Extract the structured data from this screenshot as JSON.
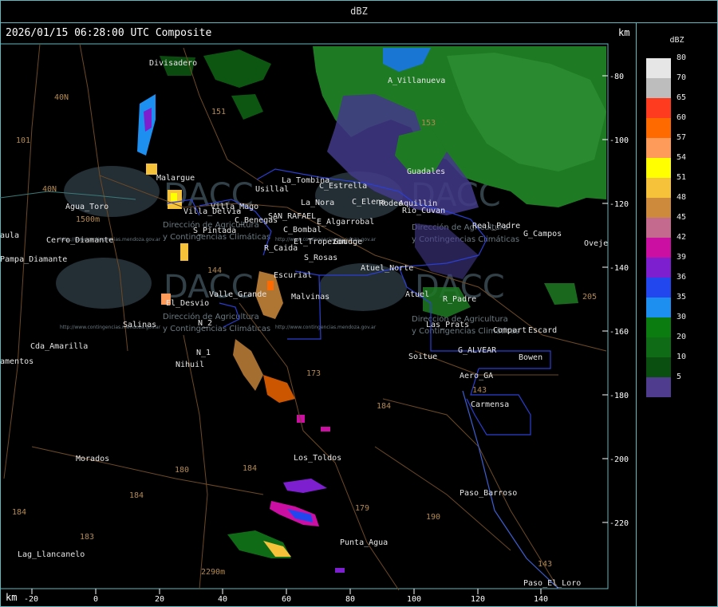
{
  "header": {
    "title": "dBZ"
  },
  "map": {
    "timestamp": "2026/01/15 06:28:00 UTC Composite",
    "unit_top": "km",
    "unit_bottom": "km",
    "x_ticks": [
      "-20",
      "0",
      "20",
      "40",
      "60",
      "80",
      "100",
      "120",
      "140"
    ],
    "y_ticks": [
      "-80",
      "-100",
      "-120",
      "-140",
      "-160",
      "-180",
      "-200",
      "-220"
    ],
    "places": [
      "Divisadero",
      "A_Villanueva",
      "La_Tombina",
      "Usillal",
      "C_Estrella",
      "La_Nora",
      "C_Elena",
      "Rodeo",
      "Aquillin",
      "Rio_Cuvan",
      "Agua_Toro",
      "Cerro_Diamante",
      "Pampa_Diamante",
      "Villa_Mago",
      "C_Benegas",
      "SAN_RAFAEL",
      "E_Algarrobal",
      "C_Bombal",
      "El_Tropezon",
      "Goudge",
      "G_Campos",
      "S_Pintada",
      "R_Caida",
      "S_Rosas",
      "Villa_Delvia",
      "Guadales",
      "Escurial",
      "Atuel_Norte",
      "Valle_Grande",
      "Malvinas",
      "El_Desvio",
      "Salinas",
      "Atuel",
      "R_Padre",
      "Compart",
      "Escard",
      "Cda_Amarilla",
      "Nihuil",
      "N_2",
      "N_1",
      "Soitue",
      "G_ALVEAR",
      "Bowen",
      "Aero_GA",
      "Carmensa",
      "Los_Toldos",
      "Morados",
      "Paso_Barroso",
      "Punta_Agua",
      "Lag_Llancanelo",
      "Paso_El_Loro",
      "Oveje",
      "amentos",
      "aula",
      "Real_Padre",
      "Las_Prats",
      "Malargue"
    ],
    "roads": [
      "40N",
      "101",
      "153",
      "40N",
      "151",
      "144",
      "173",
      "184",
      "180",
      "184",
      "184",
      "183",
      "179",
      "190",
      "143",
      "143",
      "205",
      "2290m",
      "1500m"
    ],
    "watermark": {
      "brand": "DACC",
      "line1": "Dirección de Agricultura",
      "line2": "y Contingencias Climáticas",
      "url": "http://www.contingencias.mendoza.gov.ar"
    }
  },
  "legend": {
    "title": "dBZ",
    "levels": [
      {
        "label": "80",
        "color": "#e6e6e6"
      },
      {
        "label": "70",
        "color": "#bdbdbd"
      },
      {
        "label": "65",
        "color": "#ff3b1f"
      },
      {
        "label": "60",
        "color": "#ff6a00"
      },
      {
        "label": "57",
        "color": "#ff9b5a"
      },
      {
        "label": "54",
        "color": "#ffff00"
      },
      {
        "label": "51",
        "color": "#f5c23a"
      },
      {
        "label": "48",
        "color": "#cd8a3c"
      },
      {
        "label": "45",
        "color": "#c46a8e"
      },
      {
        "label": "42",
        "color": "#cc0fa3"
      },
      {
        "label": "39",
        "color": "#7d1fcf"
      },
      {
        "label": "36",
        "color": "#2247ee"
      },
      {
        "label": "35",
        "color": "#1c8ff0"
      },
      {
        "label": "30",
        "color": "#0b7d10"
      },
      {
        "label": "20",
        "color": "#0f6b15"
      },
      {
        "label": "10",
        "color": "#0a4f10"
      },
      {
        "label": "5",
        "color": "#4f3c8f"
      }
    ]
  }
}
